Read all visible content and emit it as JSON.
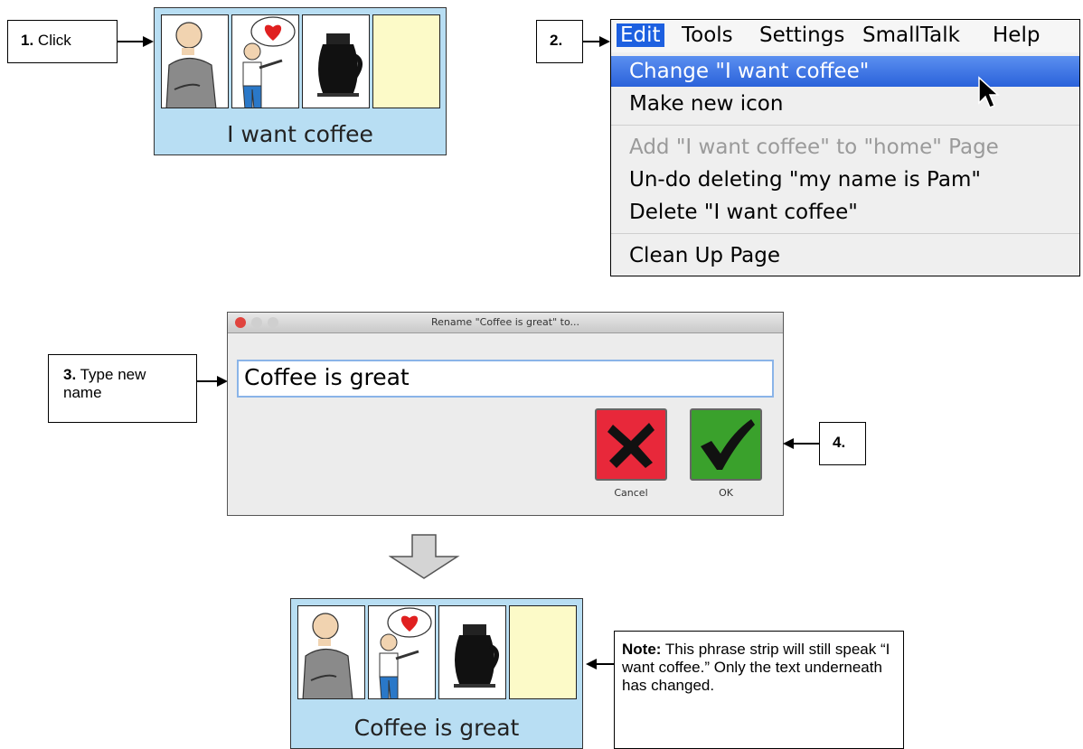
{
  "step1": {
    "num": "1.",
    "text": "Click"
  },
  "step2": {
    "num": "2."
  },
  "step3": {
    "num": "3.",
    "text": "Type new name"
  },
  "step4": {
    "num": "4."
  },
  "strip_top": {
    "caption": "I want coffee"
  },
  "strip_bottom": {
    "caption": "Coffee is great"
  },
  "menu": {
    "bar": [
      "Edit",
      "Tools",
      "Settings",
      "SmallTalk",
      "Help"
    ],
    "items": [
      "Change \"I want coffee\"",
      "Make new icon",
      "Add \"I want coffee\" to \"home\" Page",
      "Un-do deleting \"my name is Pam\"",
      "Delete \"I want coffee\"",
      "Clean Up Page"
    ]
  },
  "dialog": {
    "title": "Rename \"Coffee is great\" to...",
    "input_value": "Coffee is great",
    "cancel_label": "Cancel",
    "ok_label": "OK"
  },
  "note": {
    "label": "Note:",
    "text": "This phrase strip will still speak “I want coffee.” Only the text underneath has changed."
  },
  "colors": {
    "strip_bg": "#b8def3",
    "cancel_red": "#e8283a",
    "ok_green": "#3aa12c",
    "menu_highlight": "#2a62da"
  }
}
